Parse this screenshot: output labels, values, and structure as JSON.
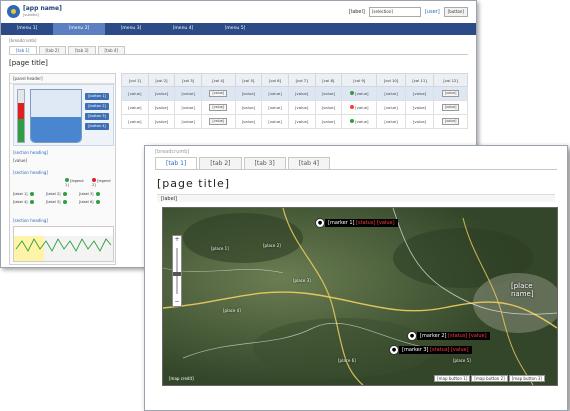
{
  "back": {
    "logo_title": "[app name]",
    "logo_sub": "[subtitle]",
    "region_label": "[label]",
    "region_select": "[selection]",
    "user_text": "[user]",
    "logout_label": "[button]",
    "nav": [
      "[menu 1]",
      "[menu 2]",
      "[menu 3]",
      "[menu 4]",
      "[menu 5]"
    ],
    "breadcrumb": "[breadcrumb]",
    "tabs": [
      "[tab 1]",
      "[tab 2]",
      "[tab 3]",
      "[tab 4]"
    ],
    "title": "[page title]",
    "panel_header": "[panel header]",
    "tank_buttons": [
      "[button 1]",
      "[button 2]",
      "[button 3]",
      "[button 4]"
    ],
    "section1": "[section heading]",
    "section1_value": "[value]",
    "section2": "[section heading]",
    "legend_on": "[legend 1]",
    "legend_off": "[legend 2]",
    "status_items": [
      {
        "label": "[label 1]",
        "state": "green"
      },
      {
        "label": "[label 2]",
        "state": "green"
      },
      {
        "label": "[label 3]",
        "state": "green"
      },
      {
        "label": "[label 4]",
        "state": "green"
      },
      {
        "label": "[label 5]",
        "state": "green"
      },
      {
        "label": "[label 6]",
        "state": "green"
      }
    ],
    "section3": "[section heading]",
    "table": {
      "headers": [
        "[col 1]",
        "[col 2]",
        "[col 3]",
        "[col 4]",
        "[col 5]",
        "[col 6]",
        "[col 7]",
        "[col 8]",
        "[col 9]",
        "[col 10]",
        "[col 11]",
        "[col 12]"
      ],
      "rows": [
        {
          "cells": [
            "[value]",
            "[value]",
            "[value]",
            "[value]",
            "[value]",
            "[value]",
            "[value]",
            "[value]",
            "[value]",
            "[value]",
            "[value]",
            "[value]"
          ],
          "status": "green"
        },
        {
          "cells": [
            "[value]",
            "[value]",
            "[value]",
            "[value]",
            "[value]",
            "[value]",
            "[value]",
            "[value]",
            "[value]",
            "[value]",
            "[value]",
            "[value]"
          ],
          "status": "red"
        },
        {
          "cells": [
            "[value]",
            "[value]",
            "[value]",
            "[value]",
            "[value]",
            "[value]",
            "[value]",
            "[value]",
            "[value]",
            "[value]",
            "[value]",
            "[value]"
          ],
          "status": "green"
        }
      ]
    }
  },
  "front": {
    "breadcrumb": "[breadcrumb]",
    "tabs": [
      "[tab 1]",
      "[tab 2]",
      "[tab 3]",
      "[tab 4]"
    ],
    "title": "[page title]",
    "subheader": "[label]",
    "markers": [
      {
        "name": "[marker 1]",
        "status": "[status]",
        "count": "[value]"
      },
      {
        "name": "[marker 2]",
        "status": "[status]",
        "count": "[value]"
      },
      {
        "name": "[marker 3]",
        "status": "[status]",
        "count": "[value]"
      }
    ],
    "city_label": "[place name]",
    "map_labels": [
      "[place 1]",
      "[place 2]",
      "[place 3]",
      "[place 4]",
      "[place 5]",
      "[place 6]"
    ],
    "scale": "[map credit]",
    "map_controls": [
      "[map button 1]",
      "[map button 2]",
      "[map button 3]"
    ]
  },
  "colors": {
    "navy": "#2b4a86",
    "accent": "#2c6ab8",
    "alert": "#ff3a3a",
    "ok": "#2e9d44"
  },
  "gauge": {
    "level": 0.45
  },
  "tank": {
    "level": 0.48
  }
}
